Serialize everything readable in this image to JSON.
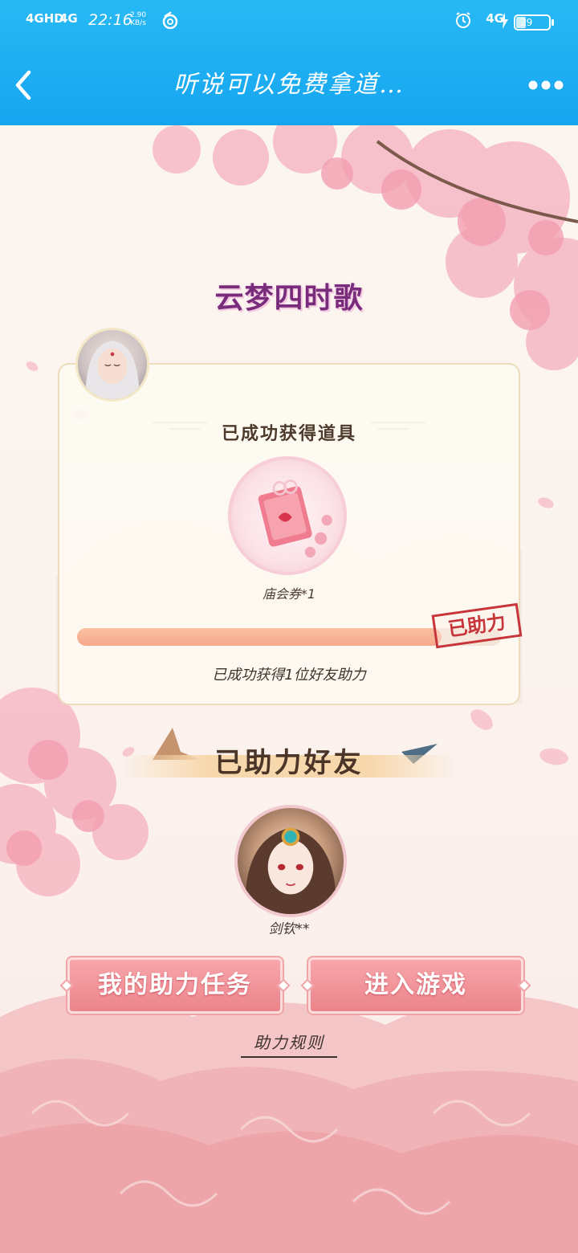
{
  "status_bar": {
    "signal_1": "4GHD",
    "signal_2": "4G",
    "time": "22:16",
    "speed_value": "2.90",
    "speed_unit": "KB/s",
    "network": "4G",
    "battery": "29"
  },
  "nav": {
    "title": "听说可以免费拿道…"
  },
  "logo": {
    "text": "云梦四时歌"
  },
  "card": {
    "title": "已成功获得道具",
    "item_label": "庙会券*1",
    "progress": 0.86,
    "stamp_text": "已助力",
    "progress_text": "已成功获得1位好友助力"
  },
  "friends": {
    "section_title": "已助力好友",
    "friend_name": "剑钦**"
  },
  "buttons": {
    "my_tasks": "我的助力任务",
    "enter_game": "进入游戏"
  },
  "rules_link": "助力规则",
  "colors": {
    "topbar": "#1aa9f2",
    "button": "#ec848b",
    "progress": "#f5a88c",
    "stamp": "#c7353a"
  }
}
